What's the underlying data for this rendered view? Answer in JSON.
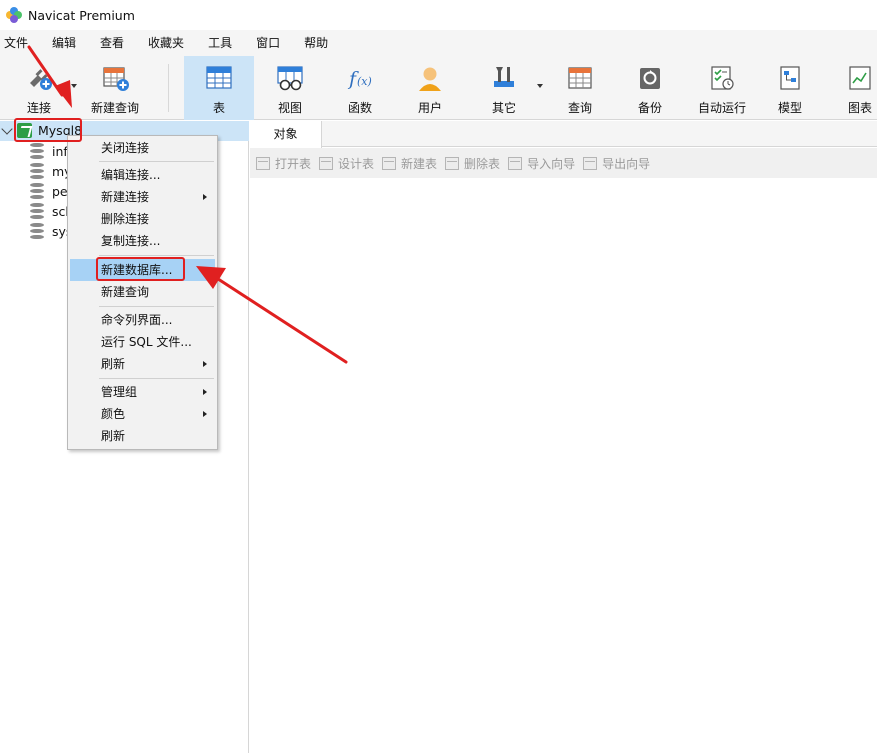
{
  "window": {
    "title": "Navicat Premium"
  },
  "menubar": [
    "文件",
    "编辑",
    "查看",
    "收藏夹",
    "工具",
    "窗口",
    "帮助"
  ],
  "toolbar": {
    "connect": "连接",
    "new_query": "新建查询",
    "table": "表",
    "view": "视图",
    "function": "函数",
    "user": "用户",
    "other": "其它",
    "query": "查询",
    "backup": "备份",
    "autorun": "自动运行",
    "model": "模型",
    "chart": "图表"
  },
  "tree": {
    "connection": "Mysql8",
    "databases": [
      "inf",
      "my",
      "pe",
      "sch",
      "sys"
    ]
  },
  "tabs": {
    "objects": "对象"
  },
  "object_toolbar": [
    "打开表",
    "设计表",
    "新建表",
    "删除表",
    "导入向导",
    "导出向导"
  ],
  "context_menu": {
    "close_conn": "关闭连接",
    "edit_conn": "编辑连接...",
    "new_conn": "新建连接",
    "delete_conn": "删除连接",
    "copy_conn": "复制连接...",
    "new_db": "新建数据库...",
    "new_query": "新建查询",
    "cmd_ui": "命令列界面...",
    "run_sql": "运行 SQL 文件...",
    "refresh1": "刷新",
    "group": "管理组",
    "color": "颜色",
    "refresh2": "刷新"
  },
  "colors": {
    "accent": "#cce4f7",
    "highlight": "#a7d2f5",
    "annotation": "#e02020"
  }
}
